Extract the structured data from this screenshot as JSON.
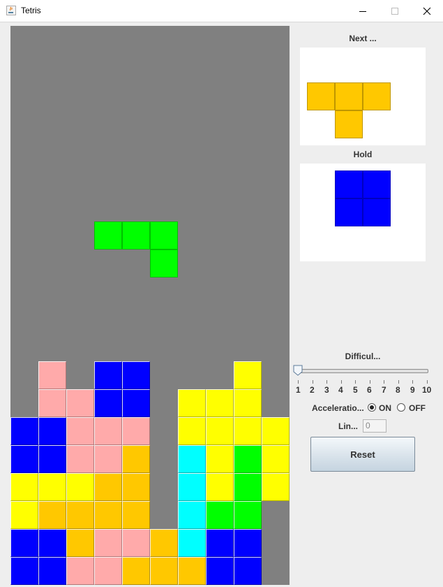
{
  "window": {
    "title": "Tetris"
  },
  "colors": {
    "P": "#ffaaaa",
    "B": "#0000ff",
    "Y": "#ffff00",
    "O": "#ffc800",
    "C": "#00ffff",
    "G": "#00ff00",
    "board_bg": "#808080"
  },
  "board": {
    "columns": 10,
    "rows": 20,
    "grid": [
      "..........",
      "..........",
      "..........",
      "..........",
      "..........",
      "..........",
      "..........",
      "..........",
      "..........",
      "..........",
      "..........",
      "..........",
      ".P.BB...Y.",
      ".PPBB.YYY.",
      "BBPPP.YYYY",
      "BBPPO.CYGY",
      "YYYOO.CYGY",
      "YOOOO.CGG.",
      "BBOPPOCBB.",
      "BBPPOOOBB."
    ],
    "falling_piece": {
      "color": "G",
      "cells": [
        [
          3,
          7
        ],
        [
          4,
          7
        ],
        [
          5,
          7
        ],
        [
          5,
          8
        ]
      ]
    }
  },
  "next": {
    "label": "Next ...",
    "color": "O",
    "cells": [
      [
        0,
        0
      ],
      [
        1,
        0
      ],
      [
        2,
        0
      ],
      [
        1,
        1
      ]
    ]
  },
  "hold": {
    "label": "Hold",
    "color": "B",
    "cells": [
      [
        0,
        0
      ],
      [
        1,
        0
      ],
      [
        0,
        1
      ],
      [
        1,
        1
      ]
    ]
  },
  "difficulty": {
    "label": "Difficul...",
    "value": 1,
    "ticks": [
      "1",
      "2",
      "3",
      "4",
      "5",
      "6",
      "7",
      "8",
      "9",
      "10"
    ]
  },
  "acceleration": {
    "label": "Acceleratio...",
    "on_label": "ON",
    "off_label": "OFF",
    "selected": "ON"
  },
  "lines": {
    "label": "Lin...",
    "value": "0"
  },
  "reset": {
    "label": "Reset"
  }
}
